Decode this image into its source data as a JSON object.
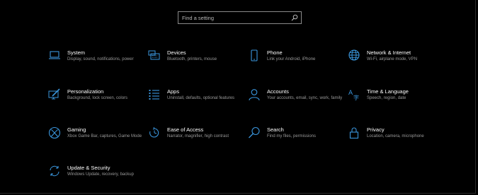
{
  "search": {
    "placeholder": "Find a setting"
  },
  "accent_color": "#3a96dd",
  "tiles": [
    {
      "id": "system",
      "icon": "laptop-icon",
      "name": "System",
      "desc": "Display, sound, notifications, power"
    },
    {
      "id": "devices",
      "icon": "keyboard-icon",
      "name": "Devices",
      "desc": "Bluetooth, printers, mouse"
    },
    {
      "id": "phone",
      "icon": "phone-icon",
      "name": "Phone",
      "desc": "Link your Android, iPhone"
    },
    {
      "id": "network",
      "icon": "globe-icon",
      "name": "Network & Internet",
      "desc": "Wi-Fi, airplane mode, VPN"
    },
    {
      "id": "personalization",
      "icon": "paint-brush-icon",
      "name": "Personalization",
      "desc": "Background, lock screen, colors"
    },
    {
      "id": "apps",
      "icon": "apps-list-icon",
      "name": "Apps",
      "desc": "Uninstall, defaults, optional features"
    },
    {
      "id": "accounts",
      "icon": "person-icon",
      "name": "Accounts",
      "desc": "Your accounts, email, sync, work, family"
    },
    {
      "id": "time-language",
      "icon": "time-language-icon",
      "name": "Time & Language",
      "desc": "Speech, region, date"
    },
    {
      "id": "gaming",
      "icon": "xbox-icon",
      "name": "Gaming",
      "desc": "Xbox Game Bar, captures, Game Mode"
    },
    {
      "id": "ease-of-access",
      "icon": "ease-of-access-icon",
      "name": "Ease of Access",
      "desc": "Narrator, magnifier, high contrast"
    },
    {
      "id": "search",
      "icon": "search-icon",
      "name": "Search",
      "desc": "Find my files, permissions"
    },
    {
      "id": "privacy",
      "icon": "lock-icon",
      "name": "Privacy",
      "desc": "Location, camera, microphone"
    },
    {
      "id": "update-security",
      "icon": "sync-icon",
      "name": "Update & Security",
      "desc": "Windows Update, recovery, backup"
    }
  ]
}
